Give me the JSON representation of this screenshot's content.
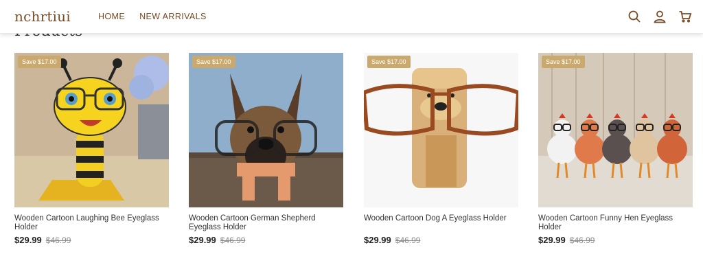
{
  "header": {
    "logo": "nchrtiui",
    "nav": [
      "HOME",
      "NEW ARRIVALS"
    ],
    "icons": [
      "search-icon",
      "account-icon",
      "cart-icon"
    ]
  },
  "section": {
    "title": "Products"
  },
  "colors": {
    "accent": "#7a4a24",
    "badge": "#c9a96e"
  },
  "products": [
    {
      "badge": "Save $17.00",
      "title": "Wooden Cartoon Laughing Bee Eyeglass Holder",
      "price": "$29.99",
      "compare_price": "$46.99"
    },
    {
      "badge": "Save $17.00",
      "title": "Wooden Cartoon German Shepherd Eyeglass Holder",
      "price": "$29.99",
      "compare_price": "$46.99"
    },
    {
      "badge": "Save $17.00",
      "title": "Wooden Cartoon Dog A Eyeglass Holder",
      "price": "$29.99",
      "compare_price": "$46.99"
    },
    {
      "badge": "Save $17.00",
      "title": "Wooden Cartoon Funny Hen Eyeglass Holder",
      "price": "$29.99",
      "compare_price": "$46.99"
    }
  ]
}
